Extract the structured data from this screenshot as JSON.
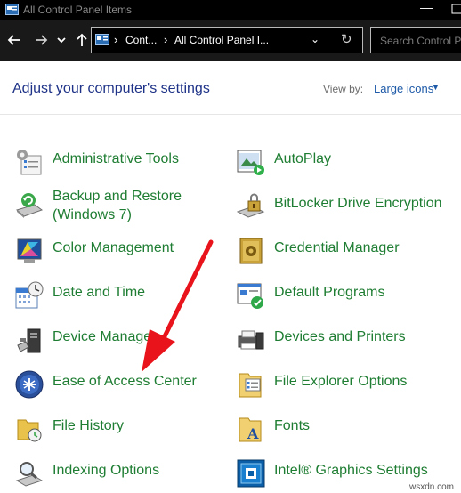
{
  "window": {
    "title": "All Control Panel Items"
  },
  "navigation": {
    "crumbs": [
      "Cont...",
      "All Control Panel I..."
    ],
    "search_placeholder": "Search Control Pa"
  },
  "header": {
    "heading": "Adjust your computer's settings",
    "view_by_label": "View by:",
    "view_by_value": "Large icons"
  },
  "items_left": [
    {
      "label": "Administrative Tools",
      "icon": "administrative-tools-icon"
    },
    {
      "label": "Backup and Restore",
      "label2": "(Windows 7)",
      "icon": "backup-restore-icon"
    },
    {
      "label": "Color Management",
      "icon": "color-management-icon"
    },
    {
      "label": "Date and Time",
      "icon": "date-time-icon"
    },
    {
      "label": "Device Manager",
      "icon": "device-manager-icon"
    },
    {
      "label": "Ease of Access Center",
      "icon": "ease-of-access-icon"
    },
    {
      "label": "File History",
      "icon": "file-history-icon"
    },
    {
      "label": "Indexing Options",
      "icon": "indexing-options-icon"
    }
  ],
  "items_right": [
    {
      "label": "AutoPlay",
      "icon": "autoplay-icon"
    },
    {
      "label": "BitLocker Drive Encryption",
      "icon": "bitlocker-icon"
    },
    {
      "label": "Credential Manager",
      "icon": "credential-manager-icon"
    },
    {
      "label": "Default Programs",
      "icon": "default-programs-icon"
    },
    {
      "label": "Devices and Printers",
      "icon": "devices-printers-icon"
    },
    {
      "label": "File Explorer Options",
      "icon": "file-explorer-options-icon"
    },
    {
      "label": "Fonts",
      "icon": "fonts-icon"
    },
    {
      "label": "Intel® Graphics Settings",
      "icon": "intel-graphics-icon"
    }
  ],
  "colors": {
    "link_green": "#1e7d32",
    "heading_blue": "#1e3287",
    "accent_blue": "#1e5aa8",
    "annotation_red": "#e8131b"
  },
  "watermark": "wsxdn.com"
}
